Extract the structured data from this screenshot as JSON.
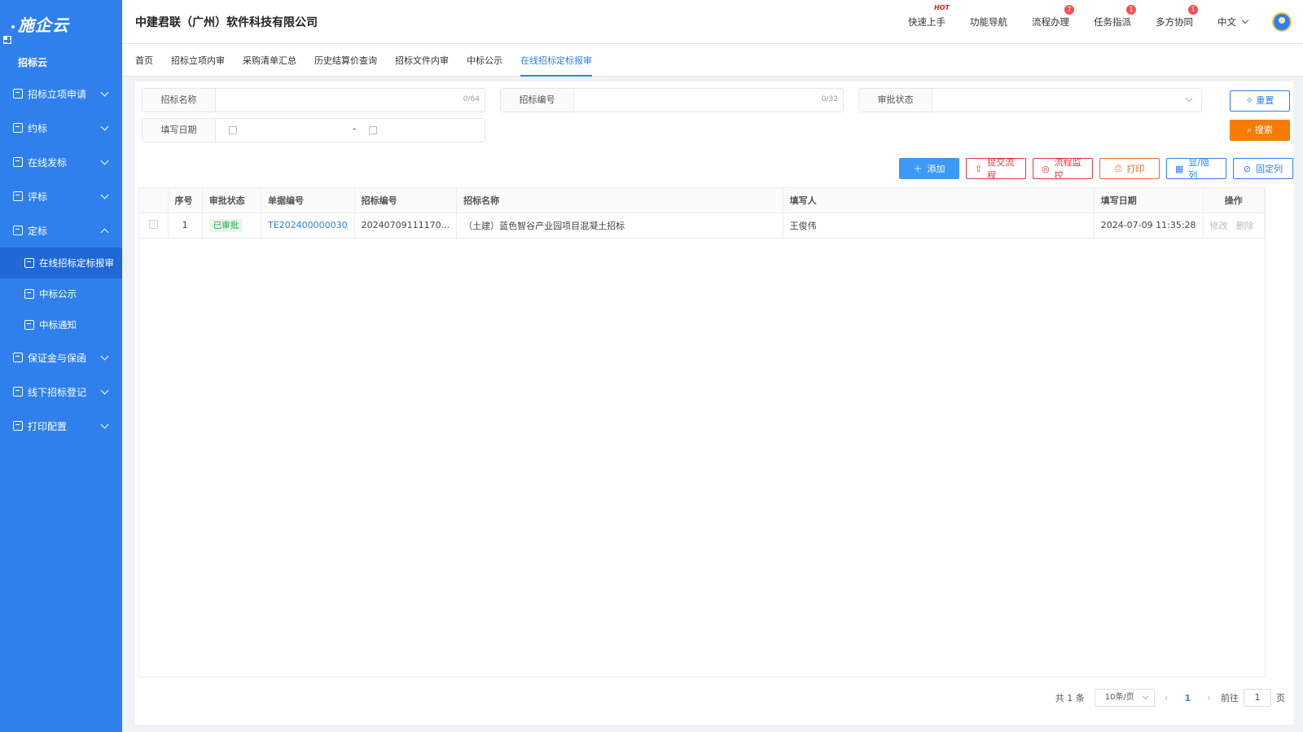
{
  "sidebar": {
    "logo": "施企云",
    "top_item": "招标云",
    "items": [
      {
        "label": "招标立项申请"
      },
      {
        "label": "约标"
      },
      {
        "label": "在线发标"
      },
      {
        "label": "评标"
      },
      {
        "label": "定标"
      },
      {
        "label": "保证金与保函"
      },
      {
        "label": "线下招标登记"
      },
      {
        "label": "打印配置"
      }
    ],
    "sub_items": [
      {
        "label": "在线招标定标报审"
      },
      {
        "label": "中标公示"
      },
      {
        "label": "中标通知"
      }
    ]
  },
  "header": {
    "company": "中建君联（广州）软件科技有限公司",
    "menu": [
      {
        "label": "快速上手",
        "tag": "HOT"
      },
      {
        "label": "功能导航"
      },
      {
        "label": "流程办理",
        "badge": "7"
      },
      {
        "label": "任务指派",
        "badge": "1"
      },
      {
        "label": "多方协同",
        "badge": "1"
      }
    ],
    "language": "中文"
  },
  "tabs": [
    "首页",
    "招标立项内审",
    "采购清单汇总",
    "历史结算价查询",
    "招标文件内审",
    "中标公示",
    "在线招标定标报审"
  ],
  "filter": {
    "name_label": "招标名称",
    "name_count": "0/64",
    "code_label": "招标编号",
    "code_count": "0/32",
    "status_label": "审批状态",
    "date_label": "填写日期",
    "date_sep": "-",
    "reset": "重置",
    "search": "搜索"
  },
  "toolbar": {
    "add": "添加",
    "submit": "提交流程",
    "monitor": "流程监控",
    "print": "打印",
    "toggle_cols": "显/隐列",
    "fix_cols": "固定列"
  },
  "table": {
    "headers": [
      "序号",
      "审批状态",
      "单据编号",
      "招标编号",
      "招标名称",
      "填写人",
      "填写日期",
      "操作"
    ],
    "rows": [
      {
        "index": "1",
        "status": "已审批",
        "doc_no": "TE202400000030",
        "bid_no": "20240709111170...",
        "bid_name": "（土建）蓝色智谷产业园项目混凝土招标",
        "filler": "王俊伟",
        "date": "2024-07-09 11:35:28",
        "edit": "修改",
        "delete": "删除"
      }
    ]
  },
  "pager": {
    "total": "共 1 条",
    "page_size": "10条/页",
    "current": "1",
    "goto_label": "前往",
    "goto_value": "1",
    "page_suffix": "页"
  },
  "colors": {
    "primary": "#2f80ed",
    "search": "#f57c00",
    "danger": "#e03a3a"
  }
}
